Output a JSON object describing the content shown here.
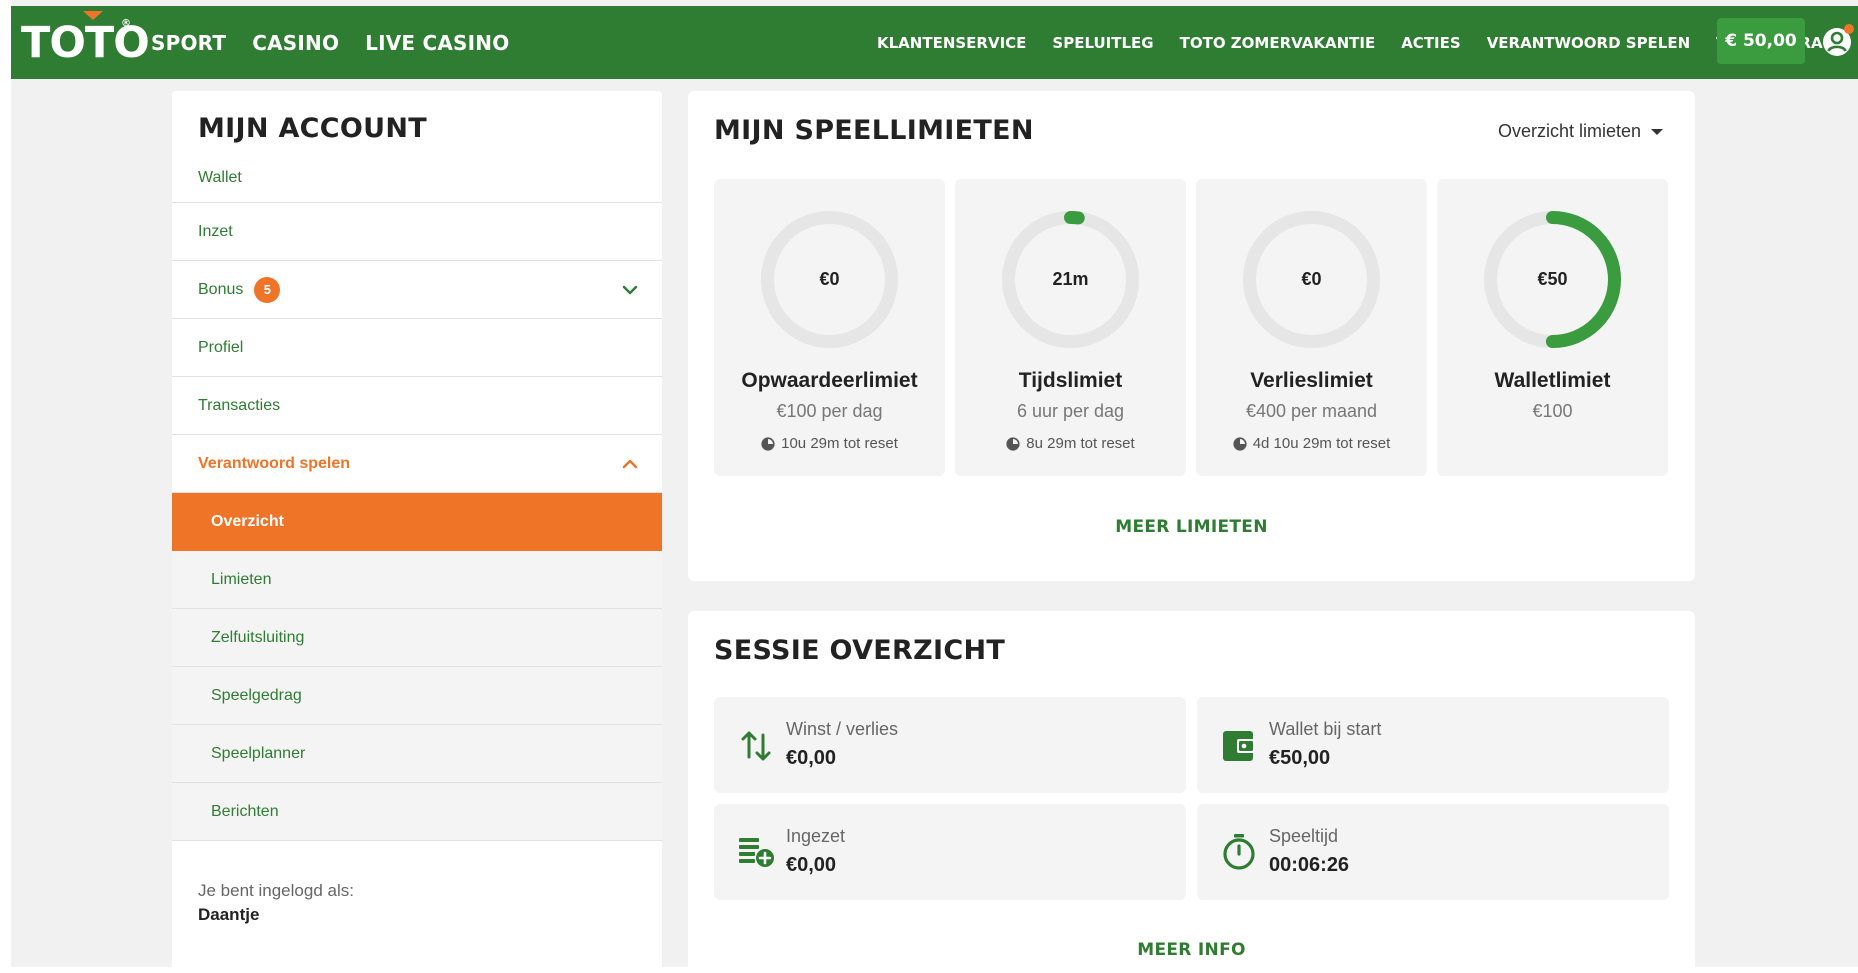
{
  "brand": {
    "logo_text": "TOTO",
    "registered": "®"
  },
  "nav": {
    "main": [
      "SPORT",
      "CASINO",
      "LIVE CASINO"
    ],
    "right": [
      "KLANTENSERVICE",
      "SPELUITLEG",
      "TOTO ZOMERVAKANTIE",
      "ACTIES",
      "VERANTWOORD SPELEN",
      "TOTO EXTRA"
    ],
    "balance": "€ 50,00",
    "user_icon": "user-account-icon",
    "notification_dot_color": "#ef7427"
  },
  "colors": {
    "primary_green": "#2e7d32",
    "accent_orange": "#ef7427",
    "ring_track": "#e6e6e6"
  },
  "sidebar": {
    "title": "MIJN ACCOUNT",
    "items": [
      {
        "label": "Wallet"
      },
      {
        "label": "Inzet"
      },
      {
        "label": "Bonus",
        "badge": "5"
      },
      {
        "label": "Profiel"
      },
      {
        "label": "Transacties"
      },
      {
        "label": "Verantwoord spelen"
      }
    ],
    "subitems": [
      {
        "label": "Overzicht",
        "active": true
      },
      {
        "label": "Limieten"
      },
      {
        "label": "Zelfuitsluiting"
      },
      {
        "label": "Speelgedrag"
      },
      {
        "label": "Speelplanner"
      },
      {
        "label": "Berichten"
      }
    ],
    "logged_in_label": "Je bent ingelogd als:",
    "logged_in_user": "Daantje"
  },
  "limits": {
    "title": "MIJN SPEELLIMIETEN",
    "dropdown": "Overzicht limieten",
    "tiles": [
      {
        "value": "€0",
        "name": "Opwaardeerlimiet",
        "sub": "€100 per dag",
        "reset": "10u 29m tot reset",
        "fraction": 0
      },
      {
        "value": "21m",
        "name": "Tijdslimiet",
        "sub": "6 uur per dag",
        "reset": "8u 29m tot reset",
        "fraction": 0.02
      },
      {
        "value": "€0",
        "name": "Verlieslimiet",
        "sub": "€400 per maand",
        "reset": "4d 10u 29m tot reset",
        "fraction": 0
      },
      {
        "value": "€50",
        "name": "Walletlimiet",
        "sub": "€100",
        "reset": "",
        "fraction": 0.5
      }
    ],
    "more": "MEER LIMIETEN"
  },
  "session": {
    "title": "SESSIE OVERZICHT",
    "boxes": [
      {
        "icon": "up-down-arrows-icon",
        "label": "Winst / verlies",
        "value": "€0,00"
      },
      {
        "icon": "wallet-icon",
        "label": "Wallet bij start",
        "value": "€50,00"
      },
      {
        "icon": "coins-add-icon",
        "label": "Ingezet",
        "value": "€0,00"
      },
      {
        "icon": "stopwatch-icon",
        "label": "Speeltijd",
        "value": "00:06:26"
      }
    ],
    "more": "MEER INFO"
  }
}
